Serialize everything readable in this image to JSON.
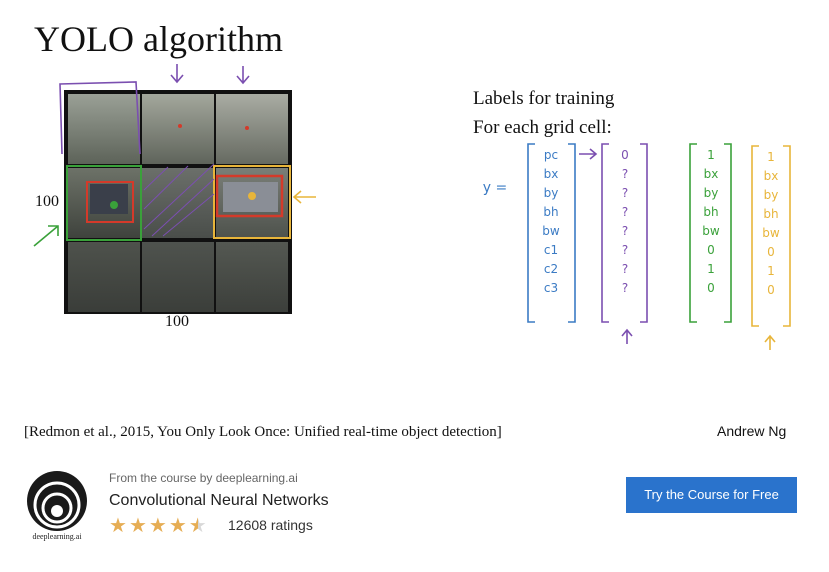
{
  "slide": {
    "title": "YOLO algorithm",
    "grid_size_label_left": "100",
    "grid_size_label_bottom": "100",
    "labels_heading_line1": "Labels for training",
    "labels_heading_line2": "For each grid cell:",
    "y_label": "y =",
    "vector_main": [
      "pc",
      "bx",
      "by",
      "bh",
      "bw",
      "c1",
      "c2",
      "c3"
    ],
    "vector_empty_cell": [
      "0",
      "?",
      "?",
      "?",
      "?",
      "?",
      "?",
      "?"
    ],
    "vector_car_green": [
      "1",
      "bx",
      "by",
      "bh",
      "bw",
      "0",
      "1",
      "0"
    ],
    "vector_car_yellow": [
      "1",
      "bx",
      "by",
      "bh",
      "bw",
      "0",
      "1",
      "0"
    ],
    "citation": "[Redmon et al., 2015, You Only Look Once: Unified real-time object detection]",
    "author": "Andrew Ng"
  },
  "colors": {
    "ink_purple": "#7b4fb0",
    "ink_green": "#3aa13a",
    "ink_yellow": "#e8b53a",
    "ink_blue": "#3b7bc4",
    "ink_red": "#d43a2a",
    "cta_blue": "#2a73cc",
    "star_orange": "#e6ad54"
  },
  "footer": {
    "logo_icon": "deeplearning-ai-logo-icon",
    "logo_text": "deeplearning.ai",
    "from_course": "From the course by deeplearning.ai",
    "course_name": "Convolutional Neural Networks",
    "rating": 4.5,
    "ratings_count": "12608 ratings",
    "cta_label": "Try the Course for Free"
  }
}
